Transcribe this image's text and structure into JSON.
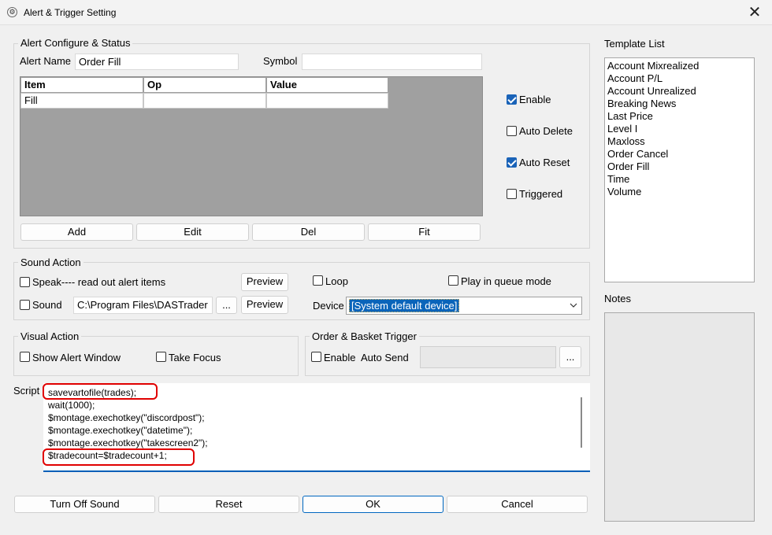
{
  "window": {
    "title": "Alert & Trigger Setting",
    "close_glyph": "✕"
  },
  "alert_group": {
    "label": "Alert Configure & Status",
    "alert_name_label": "Alert Name",
    "alert_name_value": "Order Fill",
    "symbol_label": "Symbol",
    "symbol_value": "",
    "columns": [
      "Item",
      "Op",
      "Value"
    ],
    "rows": [
      [
        "Fill",
        "",
        ""
      ]
    ],
    "buttons": {
      "add": "Add",
      "edit": "Edit",
      "del": "Del",
      "fit": "Fit"
    },
    "checks": [
      {
        "label": "Enable",
        "checked": true
      },
      {
        "label": "Auto Delete",
        "checked": false
      },
      {
        "label": "Auto Reset",
        "checked": true
      },
      {
        "label": "Triggered",
        "checked": false
      }
    ]
  },
  "sound_group": {
    "label": "Sound Action",
    "speak_label": "Speak---- read out alert items",
    "preview_label": "Preview",
    "loop_label": "Loop",
    "play_queue_label": "Play in queue mode",
    "sound_label": "Sound",
    "sound_path": "C:\\Program Files\\DASTrader",
    "browse_label": "...",
    "device_label": "Device",
    "device_value": "[System default device]"
  },
  "visual_group": {
    "label": "Visual Action",
    "show_alert_label": "Show Alert Window",
    "take_focus_label": "Take Focus"
  },
  "order_group": {
    "label": "Order & Basket Trigger",
    "enable_label": "Enable",
    "auto_send_label": "Auto Send",
    "browse_label": "..."
  },
  "script": {
    "label": "Script",
    "lines": [
      "savevartofile(trades);",
      "wait(1000);",
      "$montage.exechotkey(\"discordpost\");",
      "$montage.exechotkey(\"datetime\");",
      "$montage.exechotkey(\"takescreen2\");",
      "$tradecount=$tradecount+1;"
    ]
  },
  "bottom_buttons": {
    "turn_off_sound": "Turn Off Sound",
    "reset": "Reset",
    "ok": "OK",
    "cancel": "Cancel"
  },
  "template_list": {
    "label": "Template List",
    "items": [
      "Account Mixrealized",
      "Account P/L",
      "Account Unrealized",
      "Breaking News",
      "Last Price",
      "Level I",
      "Maxloss",
      "Order Cancel",
      "Order Fill",
      "Time",
      "Volume"
    ]
  },
  "notes": {
    "label": "Notes"
  },
  "colors": {
    "accent": "#1a63b8",
    "highlight_ring": "#e00000",
    "grid_bg": "#a0a0a0"
  }
}
